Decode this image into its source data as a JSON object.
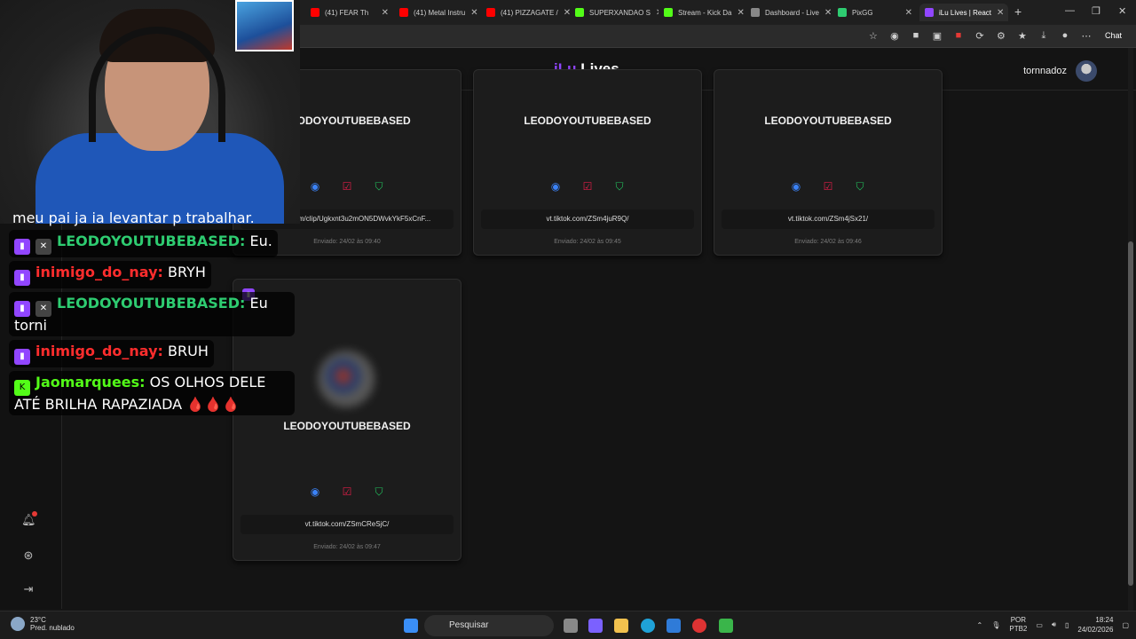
{
  "browser": {
    "tabs": [
      {
        "label": "(41) FEAR Th",
        "color": "#ff0000"
      },
      {
        "label": "(41) Metal Instru",
        "color": "#ff0000"
      },
      {
        "label": "(41) PIZZAGATE /",
        "color": "#ff0000"
      },
      {
        "label": "SUPERXANDAO S",
        "color": "#53fc18"
      },
      {
        "label": "Stream - Kick Da",
        "color": "#53fc18"
      },
      {
        "label": "Dashboard - Live",
        "color": "#888888"
      },
      {
        "label": "PixGG",
        "color": "#2ecc71"
      },
      {
        "label": "iLu Lives | React",
        "color": "#9146ff"
      }
    ],
    "chat_button": "Chat"
  },
  "app": {
    "brand_prefix": "iLu",
    "brand_suffix": "Lives",
    "username": "tornnadoz",
    "accent": "#9146ff"
  },
  "cards": [
    {
      "name": "LEODOYOUTUBEBASED",
      "link": "youtube.com/clip/Ugkxnt3u2mON5DWvkYkF5xCnF...",
      "sent": "Enviado: 24/02 às 09:40"
    },
    {
      "name": "LEODOYOUTUBEBASED",
      "link": "vt.tiktok.com/ZSm4juR9Q/",
      "sent": "Enviado: 24/02 às 09:45"
    },
    {
      "name": "LEODOYOUTUBEBASED",
      "link": "vt.tiktok.com/ZSm4jSx21/",
      "sent": "Enviado: 24/02 às 09:46"
    },
    {
      "name": "LEODOYOUTUBEBASED",
      "link": "vt.tiktok.com/ZSmCReSjC/",
      "sent": "Enviado: 24/02 às 09:47"
    }
  ],
  "overlay_chat": [
    {
      "user": "",
      "text": "meu pai ja ia levantar p trabalhar."
    },
    {
      "user": "LEODOYOUTUBEBASED:",
      "text": "Eu."
    },
    {
      "user": "inimigo_do_nay:",
      "text": "BRYH"
    },
    {
      "user": "LEODOYOUTUBEBASED:",
      "text": "Eu torni"
    },
    {
      "user": "inimigo_do_nay:",
      "text": "BRUH"
    },
    {
      "user": "Jaomarquees:",
      "text": "OS OLHOS DELE ATÉ BRILHA RAPAZIADA 🩸🩸🩸"
    }
  ],
  "taskbar": {
    "temp": "23°C",
    "weather": "Pred. nublado",
    "search": "Pesquisar",
    "lang1": "POR",
    "lang2": "PTB2",
    "time": "18:24",
    "date": "24/02/2026"
  }
}
